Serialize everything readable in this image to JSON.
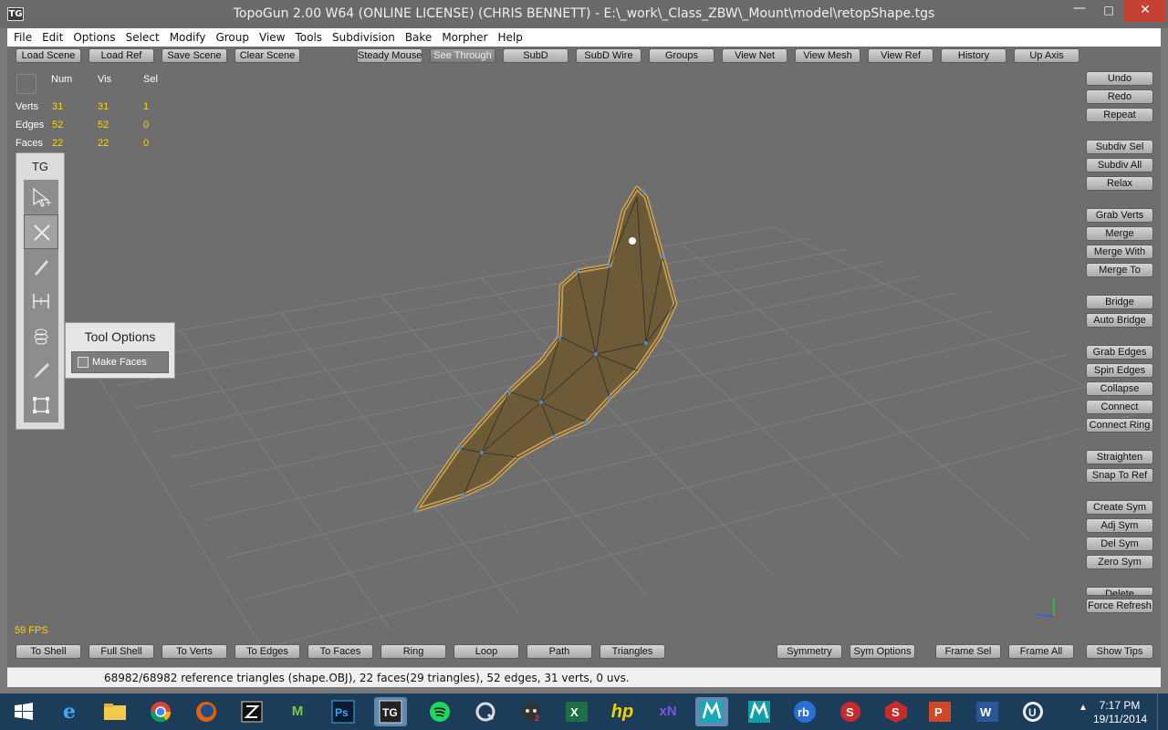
{
  "window": {
    "title": "TopoGun 2.00 W64  (ONLINE LICENSE) (CHRIS BENNETT) - E:\\_work\\_Class_ZBW\\_Mount\\model\\retopShape.tgs",
    "logo_text": "TG"
  },
  "menu": [
    "File",
    "Edit",
    "Options",
    "Select",
    "Modify",
    "Group",
    "View",
    "Tools",
    "Subdivision",
    "Bake",
    "Morpher",
    "Help"
  ],
  "toolbar_top": [
    "Load Scene",
    "Load Ref",
    "Save Scene",
    "Clear Scene",
    "Steady Mouse",
    "See Through",
    "SubD",
    "SubD Wire",
    "Groups",
    "View Net",
    "View Mesh",
    "View Ref",
    "History",
    "Up Axis"
  ],
  "toolbar_right": [
    "Undo",
    "Redo",
    "Repeat",
    "Subdiv Sel",
    "Subdiv All",
    "Relax",
    "Grab Verts",
    "Merge",
    "Merge With",
    "Merge To",
    "Bridge",
    "Auto Bridge",
    "Grab Edges",
    "Spin Edges",
    "Collapse",
    "Connect",
    "Connect Ring",
    "Straighten",
    "Snap To Ref",
    "Create Sym",
    "Adj Sym",
    "Del Sym",
    "Zero Sym",
    "Delete",
    "Force Refresh",
    "Show Tips"
  ],
  "toolbar_bottom": [
    "To Shell",
    "Full Shell",
    "To Verts",
    "To Edges",
    "To Faces",
    "Ring",
    "Loop",
    "Path",
    "Triangles",
    "Symmetry",
    "Sym Options",
    "Frame Sel",
    "Frame All"
  ],
  "stats": {
    "headers": [
      "Num",
      "Vis",
      "Sel"
    ],
    "rows": [
      {
        "label": "Verts",
        "num": "31",
        "vis": "31",
        "sel": "1"
      },
      {
        "label": "Edges",
        "num": "52",
        "vis": "52",
        "sel": "0"
      },
      {
        "label": "Faces",
        "num": "22",
        "vis": "22",
        "sel": "0"
      }
    ]
  },
  "tool_panel": {
    "label": "TG",
    "tools": [
      "select-tool-icon",
      "cut-tool-icon",
      "draw-tool-icon",
      "bridge-tool-icon",
      "spiral-tool-icon",
      "brush-tool-icon",
      "tweak-tool-icon"
    ]
  },
  "tool_options": {
    "title": "Tool Options",
    "make_faces_label": "Make Faces"
  },
  "fps": "59 FPS",
  "status": "68982/68982 reference triangles (shape.OBJ), 22 faces(29 triangles), 52 edges, 31 verts, 0 uvs.",
  "taskbar": {
    "time": "7:17 PM",
    "date": "19/11/2014"
  },
  "colors": {
    "viewport_bg": "#6e6e6e",
    "stat_values": "#ffd400",
    "mesh": "#8a6e3a",
    "taskbar": "#1c3d5a"
  }
}
